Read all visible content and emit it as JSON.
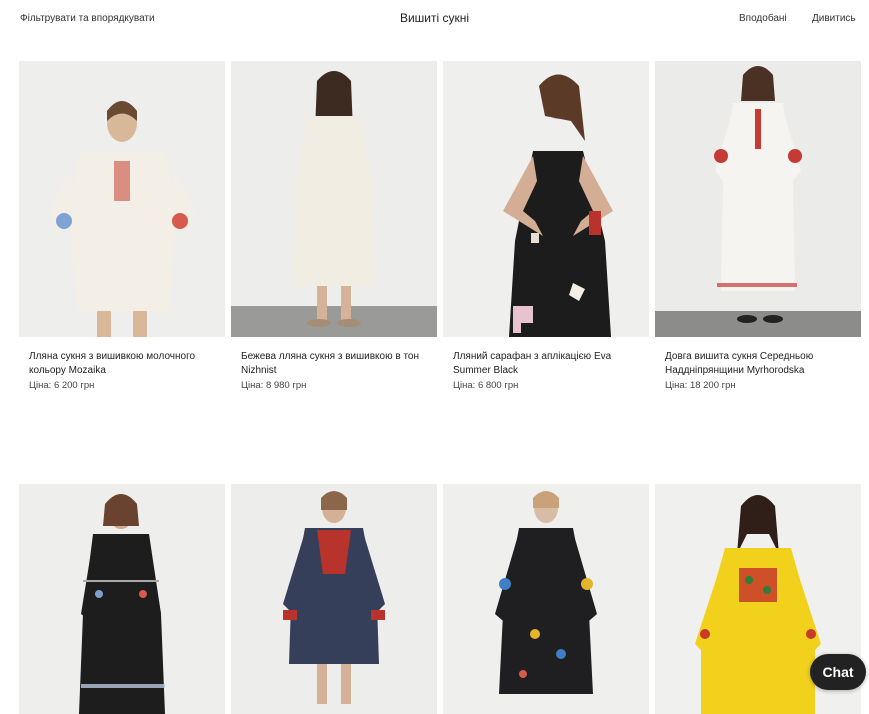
{
  "header": {
    "filter_label": "Фільтрувати та впорядкувати",
    "title": "Вишиті сукні",
    "liked_label": "Вподобані",
    "view_label": "Дивитись"
  },
  "products": [
    {
      "title": "Лляна сукня з вишивкою молочного кольору Mozaika",
      "price": "Ціна: 6 200 грн"
    },
    {
      "title": "Бежева лляна сукня з вишивкою в тон Nizhnist",
      "price": "Ціна: 8 980 грн"
    },
    {
      "title": "Лляний сарафан з аплікацією Eva Summer Black",
      "price": "Ціна: 6 800 грн"
    },
    {
      "title": "Довга вишита сукня Середньою Наддніпрянщини Myrhorodska",
      "price": "Ціна: 18 200 грн"
    }
  ],
  "chat": {
    "label": "Chat"
  },
  "colors": {
    "background": "#ffffff",
    "photo_bg": "#efefef",
    "chat_bg": "#222222"
  }
}
